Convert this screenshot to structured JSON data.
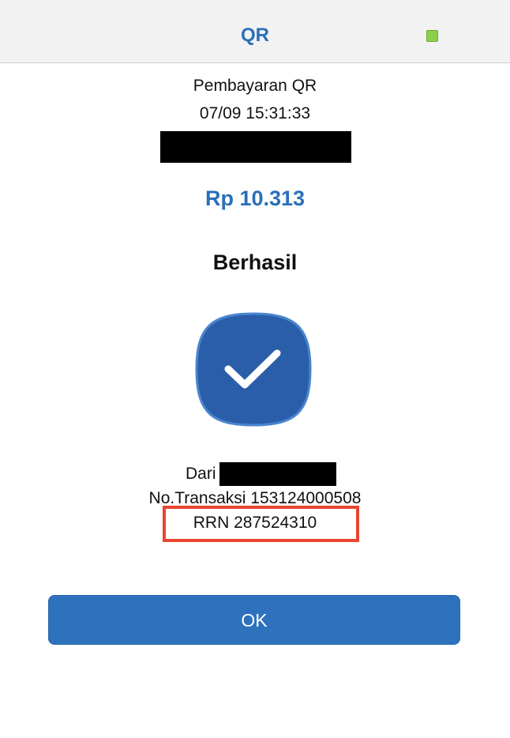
{
  "header": {
    "title": "QR",
    "status_color": "#8bd04a"
  },
  "receipt": {
    "payment_type": "Pembayaran QR",
    "datetime": "07/09 15:31:33",
    "amount": "Rp 10.313",
    "status": "Berhasil",
    "status_icon": "check-icon",
    "from_label": "Dari",
    "transaction_line": "No.Transaksi 153124000508",
    "rrn_line": "RRN 287524310"
  },
  "actions": {
    "ok_label": "OK"
  },
  "colors": {
    "accent": "#2a6fb8",
    "button": "#2e72bd",
    "icon_bg": "#2a5ea8",
    "highlight": "#e8452f"
  }
}
